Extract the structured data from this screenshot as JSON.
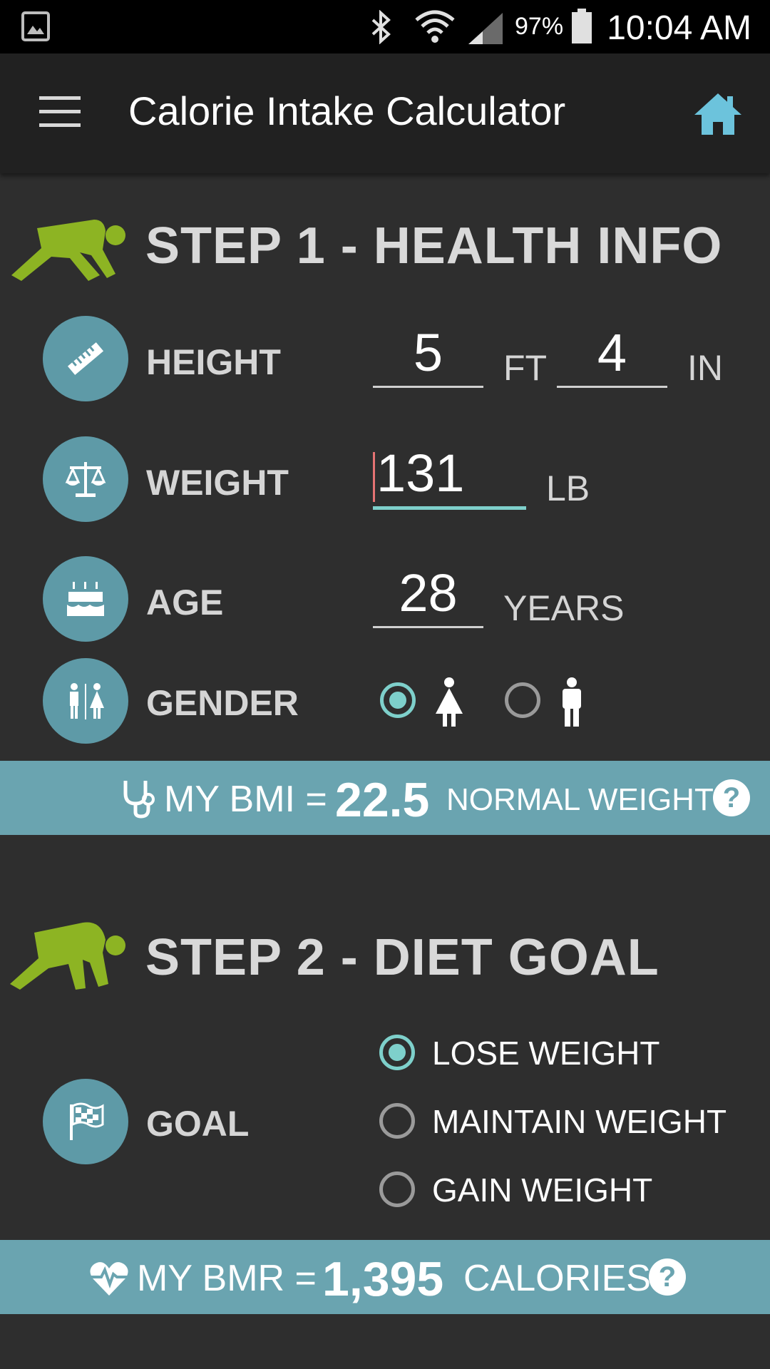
{
  "status_bar": {
    "battery_percent": "97%",
    "time": "10:04 AM",
    "icons": [
      "gallery-icon",
      "bluetooth-icon",
      "wifi-icon",
      "signal-icon",
      "battery-icon"
    ]
  },
  "app_bar": {
    "title": "Calorie Intake Calculator",
    "menu_icon": "menu-icon",
    "home_icon": "home-icon"
  },
  "step1": {
    "title": "STEP 1 - HEALTH INFO",
    "height": {
      "label": "HEIGHT",
      "feet": "5",
      "feet_unit": "FT",
      "inches": "4",
      "inches_unit": "IN"
    },
    "weight": {
      "label": "WEIGHT",
      "value": "131",
      "unit": "LB"
    },
    "age": {
      "label": "AGE",
      "value": "28",
      "unit": "YEARS"
    },
    "gender": {
      "label": "GENDER",
      "options": [
        "female",
        "male"
      ],
      "selected": "female"
    }
  },
  "bmi": {
    "label": "MY BMI =",
    "value": "22.5",
    "status": "NORMAL WEIGHT",
    "help": "?"
  },
  "step2": {
    "title": "STEP 2 - DIET GOAL",
    "goal": {
      "label": "GOAL",
      "options": [
        "LOSE WEIGHT",
        "MAINTAIN WEIGHT",
        "GAIN WEIGHT"
      ],
      "selected": "LOSE WEIGHT"
    }
  },
  "bmr": {
    "label": "MY BMR =",
    "value": "1,395",
    "unit": "CALORIES",
    "help": "?"
  },
  "colors": {
    "background": "#2e2e2e",
    "app_bar": "#212121",
    "accent_teal": "#7ed0cb",
    "icon_circle": "#5e9aa7",
    "banner": "#6aa4b0",
    "runner_green": "#8db423",
    "home_icon": "#6cc3dc"
  }
}
